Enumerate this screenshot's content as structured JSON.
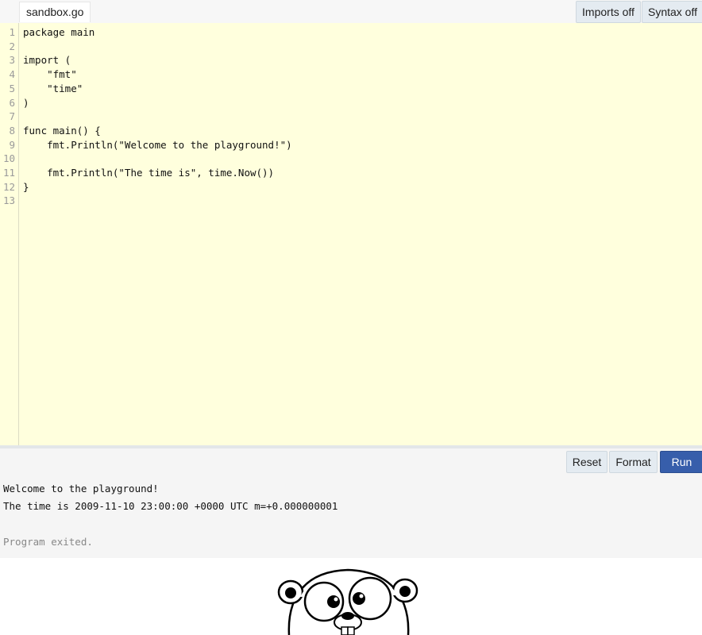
{
  "header": {
    "file_tab": "sandbox.go",
    "imports_label": "Imports off",
    "syntax_label": "Syntax off"
  },
  "editor": {
    "line_numbers": [
      "1",
      "2",
      "3",
      "4",
      "5",
      "6",
      "7",
      "8",
      "9",
      "10",
      "11",
      "12",
      "13"
    ],
    "lines": [
      "package main",
      "",
      "import (",
      "    \"fmt\"",
      "    \"time\"",
      ")",
      "",
      "func main() {",
      "    fmt.Println(\"Welcome to the playground!\")",
      "",
      "    fmt.Println(\"The time is\", time.Now())",
      "}",
      ""
    ]
  },
  "actions": {
    "reset_label": "Reset",
    "format_label": "Format",
    "run_label": "Run"
  },
  "output": {
    "lines": [
      "Welcome to the playground!",
      "The time is 2009-11-10 23:00:00 +0000 UTC m=+0.000000001"
    ],
    "status": "Program exited."
  },
  "colors": {
    "editor_bg": "#ffffdd",
    "run_button": "#375eab",
    "button_bg": "#e4ebf1"
  },
  "mascot": "gopher-mascot"
}
